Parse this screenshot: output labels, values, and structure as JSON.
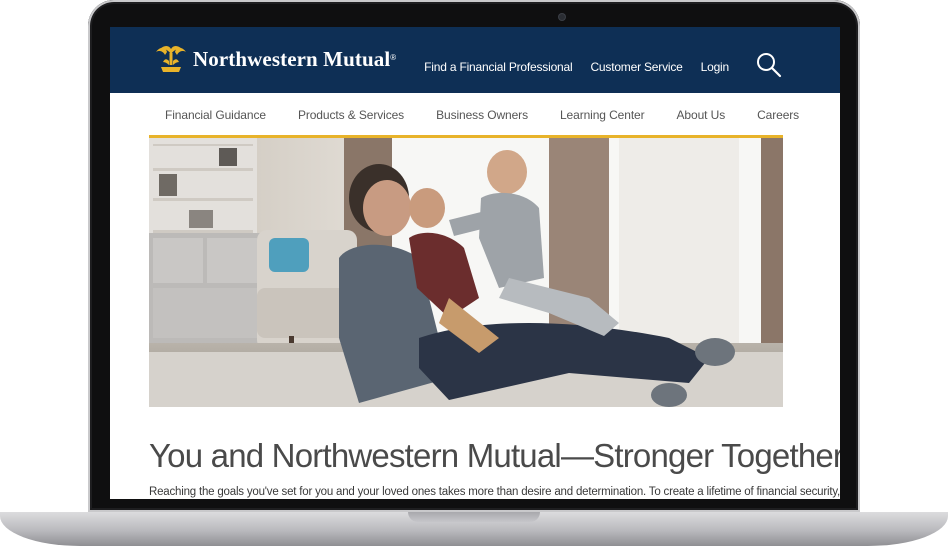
{
  "header": {
    "brand": "Northwestern Mutual",
    "brand_mark": "®",
    "top_links": [
      "Find a Financial Professional",
      "Customer Service",
      "Login"
    ],
    "search_icon": "search-icon",
    "background_color": "#0e2f55"
  },
  "nav": {
    "items": [
      "Financial Guidance",
      "Products & Services",
      "Business Owners",
      "Learning Center",
      "About Us",
      "Careers"
    ],
    "accent_color": "#e8b32a"
  },
  "hero": {
    "image": "family-playing-photo"
  },
  "content": {
    "headline": "You and Northwestern Mutual—Stronger Together",
    "intro": "Reaching the goals you've set for you and your loved ones takes more than desire and determination. To create a lifetime of financial security,"
  }
}
